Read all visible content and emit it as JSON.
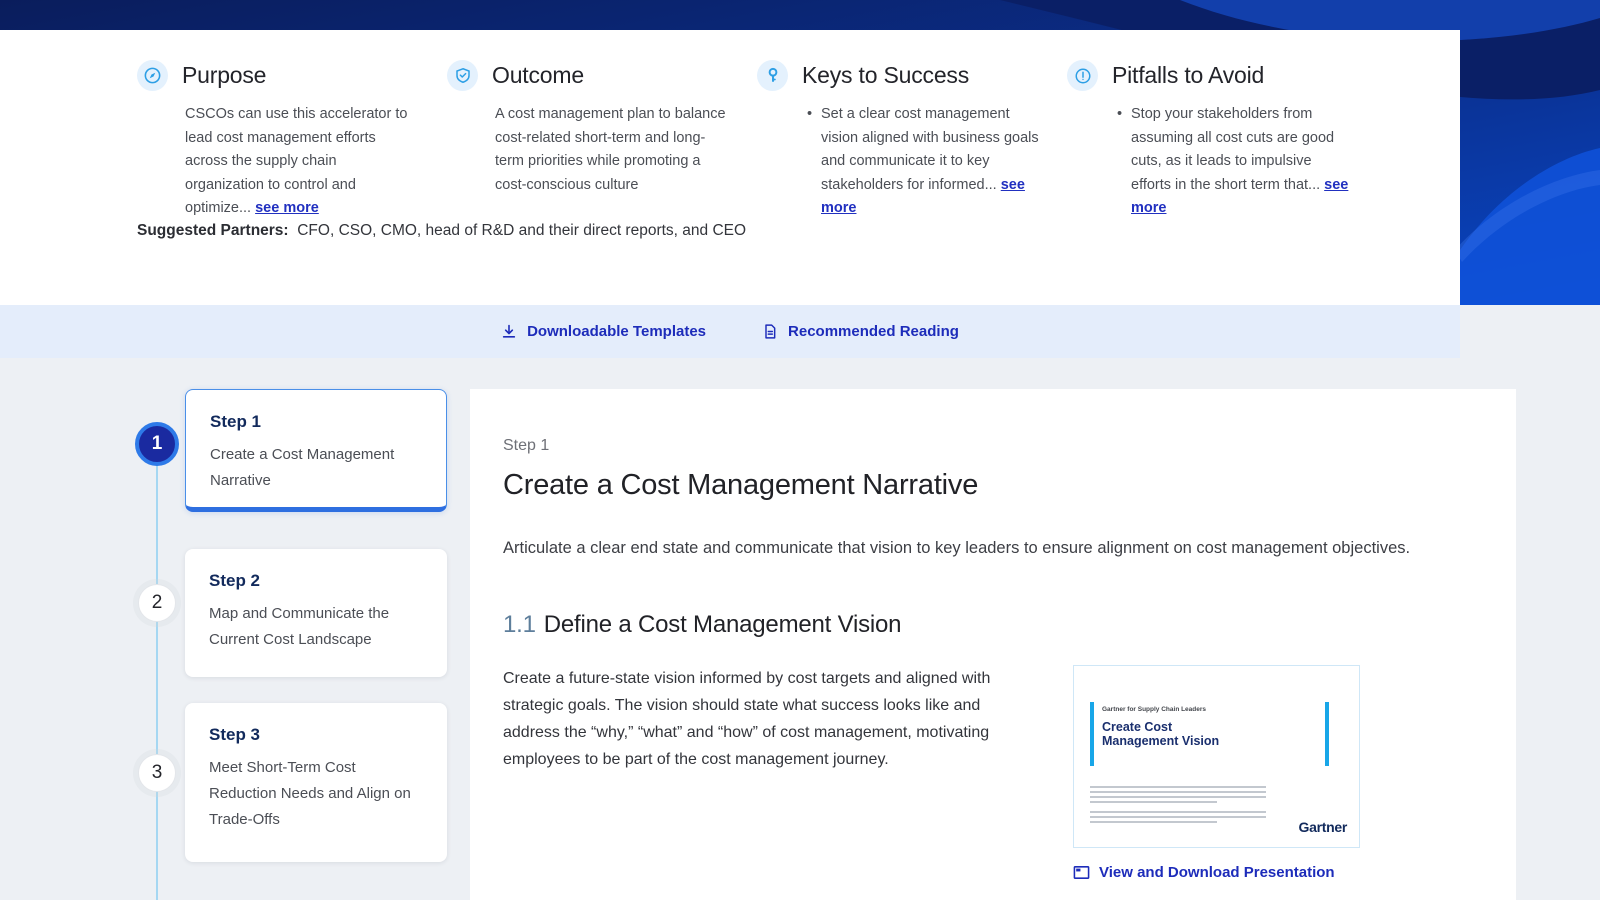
{
  "hero": {
    "columns": [
      {
        "icon": "compass-icon",
        "title": "Purpose",
        "text": "CSCOs can use this accelerator to lead cost management efforts across the supply chain organization to control and optimize... ",
        "see_more": "see more"
      },
      {
        "icon": "shield-check-icon",
        "title": "Outcome",
        "text": "A cost management plan to balance cost-related short-term and long-term priorities while promoting a cost-conscious culture",
        "see_more": ""
      },
      {
        "icon": "key-icon",
        "title": "Keys to Success",
        "text": "Set a clear cost management vision aligned with business goals and communicate it to key stakeholders for informed... ",
        "see_more": "see more"
      },
      {
        "icon": "alert-octagon-icon",
        "title": "Pitfalls to Avoid",
        "text": "Stop your stakeholders from assuming all cost cuts are good cuts, as it leads to impulsive efforts in the short term that... ",
        "see_more": "see more"
      }
    ],
    "suggested_partners_label": "Suggested Partners:",
    "suggested_partners_text": "CFO, CSO, CMO, head of R&D and their direct reports, and CEO"
  },
  "links_bar": {
    "templates_label": "Downloadable Templates",
    "reading_label": "Recommended Reading"
  },
  "stepper": [
    {
      "number": "1",
      "label": "Step 1",
      "title": "Create a Cost Management Narrative"
    },
    {
      "number": "2",
      "label": "Step 2",
      "title": "Map and Communicate the Current Cost Landscape"
    },
    {
      "number": "3",
      "label": "Step 3",
      "title": "Meet Short-Term Cost Reduction Needs and Align on Trade-Offs"
    }
  ],
  "main": {
    "step_label": "Step 1",
    "title": "Create a Cost Management Narrative",
    "intro": "Articulate a clear end state and communicate that vision to key leaders to ensure alignment on cost management objectives.",
    "section": {
      "number": "1.1",
      "title": "Define a Cost Management Vision",
      "body": "Create a future-state vision informed by cost targets and aligned with strategic goals. The vision should state what success looks like and address the “why,” “what” and “how” of cost management, motivating employees to be part of the cost management journey.",
      "download_link": "View and Download Presentation"
    },
    "slide": {
      "eyebrow": "Gartner for Supply Chain Leaders",
      "title": "Create Cost Management Vision",
      "brand": "Gartner"
    }
  },
  "colors": {
    "link_indigo": "#1d2cba",
    "icon_blue": "#2d9fe5",
    "icon_circle_bg": "#e4f1fd",
    "active_badge": "#1a2aa0",
    "active_badge_ring": "#2e7ae8",
    "bar_bg": "#e4edfb",
    "step_navy": "#122a5c",
    "hero_navy": "#0a1d5c",
    "hero_royal": "#0846c4",
    "connector_line": "#a5d7f2",
    "slide_cyan": "#18a6e8"
  }
}
